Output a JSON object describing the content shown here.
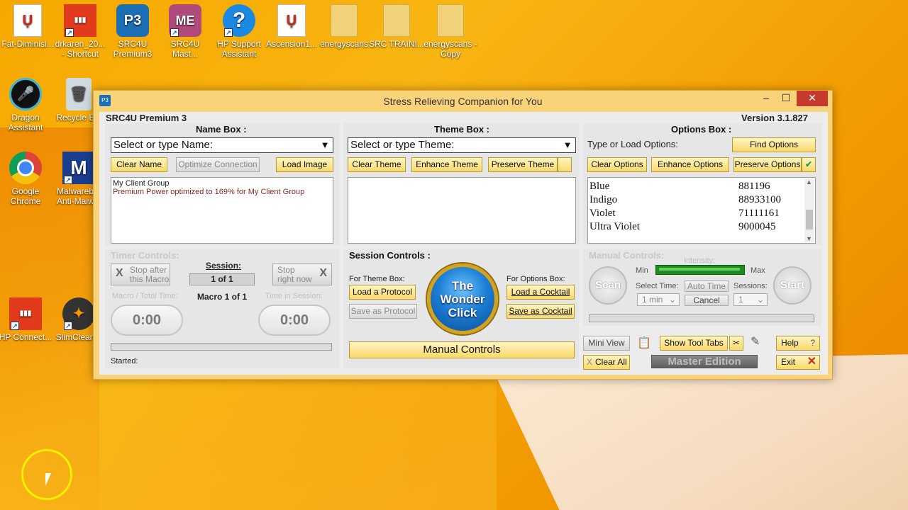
{
  "desktop": {
    "icons": [
      {
        "label": "Fat-Diminisi...",
        "icon": "pdf-icon",
        "glyph": "Ụ"
      },
      {
        "label": "drkaren_20... - Shortcut",
        "icon": "equalizer-icon",
        "glyph": "▮▮▮"
      },
      {
        "label": "SRC4U Premium3",
        "icon": "p3-icon",
        "glyph": "P3"
      },
      {
        "label": "SRC4U Mast...",
        "icon": "me-icon",
        "glyph": "ME"
      },
      {
        "label": "HP Support Assistant",
        "icon": "help-icon",
        "glyph": "?"
      },
      {
        "label": "Ascension1...",
        "icon": "pdf-icon",
        "glyph": "Ụ"
      },
      {
        "label": "energyscans",
        "icon": "folder-icon",
        "glyph": ""
      },
      {
        "label": "SRC TRAINI...",
        "icon": "folder-icon",
        "glyph": ""
      },
      {
        "label": "energyscans - Copy",
        "icon": "folder-icon",
        "glyph": ""
      },
      {
        "label": "Dragon Assistant",
        "icon": "microphone-icon",
        "glyph": "🎤"
      },
      {
        "label": "Recycle Bin",
        "icon": "recycle-bin-icon",
        "glyph": "🗑"
      },
      {
        "label": "Google Chrome",
        "icon": "chrome-icon",
        "glyph": ""
      },
      {
        "label": "Malwareb... Anti-Malw...",
        "icon": "malwarebytes-icon",
        "glyph": "M"
      },
      {
        "label": "HP Connect...",
        "icon": "equalizer-icon",
        "glyph": "▮▮▮"
      },
      {
        "label": "SlimClean...",
        "icon": "slimcleaner-icon",
        "glyph": "✦"
      }
    ]
  },
  "window": {
    "title": "Stress Relieving Companion for You",
    "app_icon": "P3",
    "min_glyph": "–",
    "max_glyph": "☐",
    "close_glyph": "✕",
    "product": "SRC4U Premium 3",
    "version": "Version 3.1.827"
  },
  "name_box": {
    "title": "Name Box :",
    "combo_placeholder": "Select or type Name:",
    "buttons": {
      "clear": "Clear Name",
      "optimize": "Optimize Connection",
      "load": "Load Image"
    },
    "text_line1": "My Client Group",
    "text_line2": "Premium Power optimized to 169% for My Client Group"
  },
  "theme_box": {
    "title": "Theme Box :",
    "combo_placeholder": "Select or type Theme:",
    "buttons": {
      "clear": "Clear Theme",
      "enhance": "Enhance Theme",
      "preserve": "Preserve Theme"
    }
  },
  "options_box": {
    "title": "Options Box :",
    "type_label": "Type or Load Options:",
    "find": "Find Options",
    "buttons": {
      "clear": "Clear Options",
      "enhance": "Enhance Options",
      "preserve": "Preserve Options"
    },
    "rows": [
      {
        "name": "Blue",
        "value": "881196"
      },
      {
        "name": "Indigo",
        "value": "88933100"
      },
      {
        "name": "Violet",
        "value": "71111161"
      },
      {
        "name": "Ultra Violet",
        "value": "9000045"
      }
    ]
  },
  "timer_controls": {
    "title": "Timer Controls:",
    "stop_after": "Stop after",
    "this_macro": "this Macro",
    "session_label": "Session:",
    "session_value": "1 of 1",
    "macro_info": "Macro  1 of 1",
    "stop": "Stop",
    "right_now": "right now",
    "macro_total_label": "Macro / Total Time:",
    "time_in_session_label": "Time in Session:",
    "macro_time": "0:00",
    "session_time": "0:00",
    "started_label": "Started:"
  },
  "session_controls": {
    "title": "Session Controls :",
    "for_theme": "For Theme Box:",
    "load_protocol": "Load a Protocol",
    "save_protocol": "Save as Protocol",
    "for_options": "For Options Box:",
    "load_cocktail": "Load a Cocktail",
    "save_cocktail": "Save as Cocktail",
    "wonder_line1": "The",
    "wonder_line2": "Wonder",
    "wonder_line3": "Click",
    "manual_controls": "Manual Controls"
  },
  "manual_controls": {
    "title": "Manual Controls:",
    "intensity": "Intensity:",
    "min": "Min",
    "max": "Max",
    "scan": "Scan",
    "start": "Start",
    "select_time": "Select Time:",
    "time_value": "1 min",
    "auto_time": "Auto Time",
    "cancel": "Cancel",
    "sessions": "Sessions:",
    "sessions_value": "1"
  },
  "bottom_right": {
    "mini_view": "Mini View",
    "show_tool_tabs": "Show Tool Tabs",
    "help": "Help",
    "help_glyph": "?",
    "clear_all": "Clear All",
    "master_edition": "Master Edition",
    "exit": "Exit",
    "exit_glyph": "✕"
  }
}
